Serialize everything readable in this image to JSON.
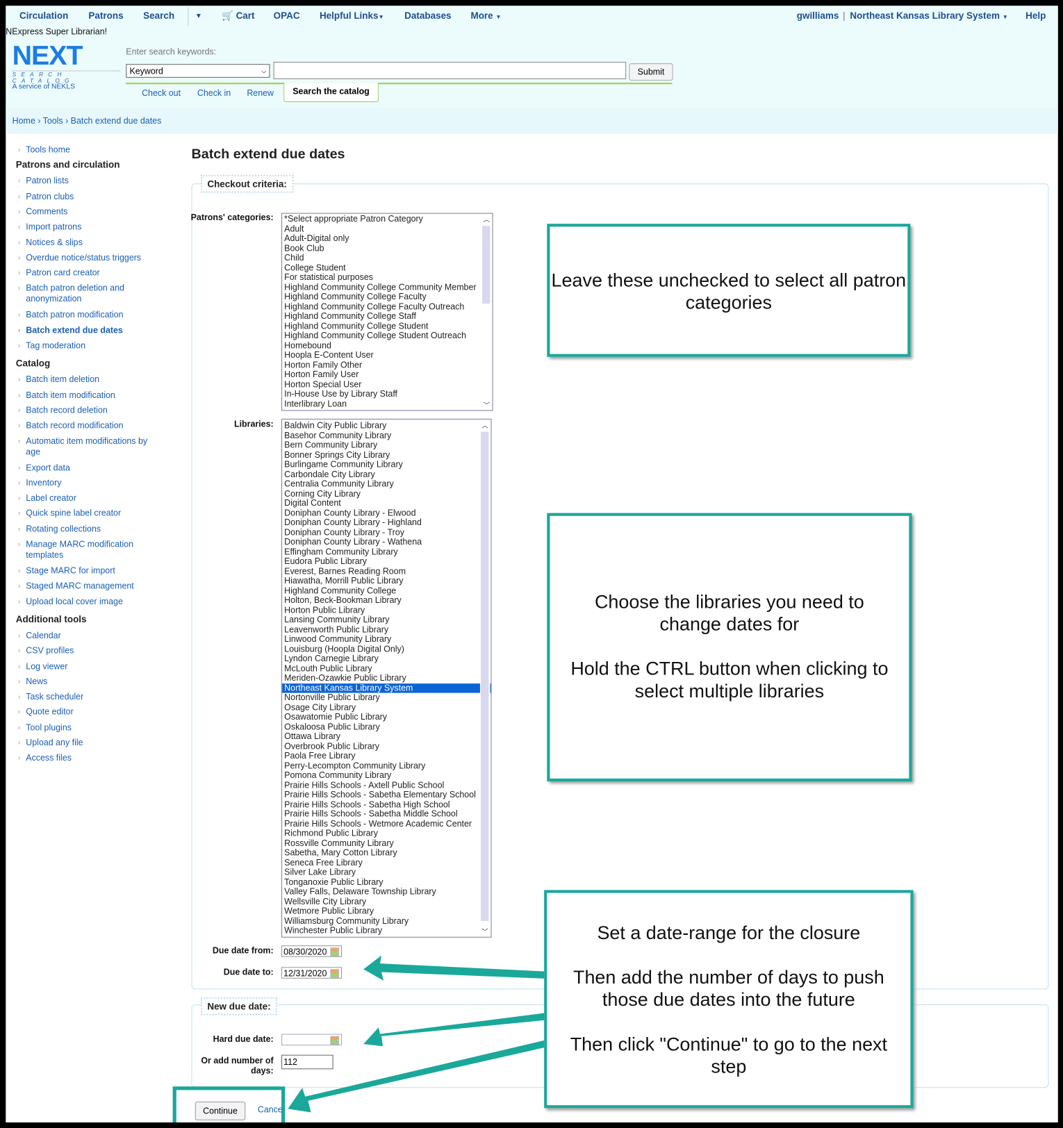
{
  "topnav": {
    "items": [
      "Circulation",
      "Patrons",
      "Search",
      "Cart",
      "OPAC",
      "Helpful Links",
      "Databases",
      "More"
    ],
    "user": "gwilliams",
    "library": "Northeast Kansas Library System",
    "help": "Help"
  },
  "greeting": "NExpress Super Librarian!",
  "logo": {
    "text": "NEXT",
    "sub": "SEARCH CATALOG",
    "service": "A service of NEKLS"
  },
  "search": {
    "prompt": "Enter search keywords:",
    "type": "Keyword",
    "value": "",
    "submit": "Submit",
    "tabs": [
      "Check out",
      "Check in",
      "Renew",
      "Search the catalog"
    ]
  },
  "breadcrumb": [
    "Home",
    "Tools",
    "Batch extend due dates"
  ],
  "sidebar": {
    "tools_home": "Tools home",
    "sections": [
      {
        "title": "Patrons and circulation",
        "items": [
          "Patron lists",
          "Patron clubs",
          "Comments",
          "Import patrons",
          "Notices & slips",
          "Overdue notice/status triggers",
          "Patron card creator",
          "Batch patron deletion and anonymization",
          "Batch patron modification",
          "Batch extend due dates",
          "Tag moderation"
        ]
      },
      {
        "title": "Catalog",
        "items": [
          "Batch item deletion",
          "Batch item modification",
          "Batch record deletion",
          "Batch record modification",
          "Automatic item modifications by age",
          "Export data",
          "Inventory",
          "Label creator",
          "Quick spine label creator",
          "Rotating collections",
          "Manage MARC modification templates",
          "Stage MARC for import",
          "Staged MARC management",
          "Upload local cover image"
        ]
      },
      {
        "title": "Additional tools",
        "items": [
          "Calendar",
          "CSV profiles",
          "Log viewer",
          "News",
          "Task scheduler",
          "Quote editor",
          "Tool plugins",
          "Upload any file",
          "Access files"
        ]
      }
    ],
    "active": "Batch extend due dates"
  },
  "main": {
    "title": "Batch extend due dates",
    "criteria_legend": "Checkout criteria:",
    "patron_label": "Patrons' categories:",
    "patron_categories": [
      "*Select appropriate Patron Category",
      "Adult",
      "Adult-Digital only",
      "Book Club",
      "Child",
      "College Student",
      "For statistical purposes",
      "Highland Community College Community Member",
      "Highland Community College Faculty",
      "Highland Community College Faculty Outreach",
      "Highland Community College Staff",
      "Highland Community College Student",
      "Highland Community College Student Outreach",
      "Homebound",
      "Hoopla E-Content User",
      "Horton Family Other",
      "Horton Family User",
      "Horton Special User",
      "In-House Use by Library Staff",
      "Interlibrary Loan"
    ],
    "libraries_label": "Libraries:",
    "libraries": [
      "Baldwin City Public Library",
      "Basehor Community Library",
      "Bern Community Library",
      "Bonner Springs City Library",
      "Burlingame Community Library",
      "Carbondale City Library",
      "Centralia Community Library",
      "Corning City Library",
      "Digital Content",
      "Doniphan County Library - Elwood",
      "Doniphan County Library - Highland",
      "Doniphan County Library - Troy",
      "Doniphan County Library - Wathena",
      "Effingham Community Library",
      "Eudora Public Library",
      "Everest, Barnes Reading Room",
      "Hiawatha, Morrill Public Library",
      "Highland Community College",
      "Holton, Beck-Bookman Library",
      "Horton Public Library",
      "Lansing Community Library",
      "Leavenworth Public Library",
      "Linwood Community Library",
      "Louisburg (Hoopla Digital Only)",
      "Lyndon Carnegie Library",
      "McLouth Public Library",
      "Meriden-Ozawkie Public Library",
      "Northeast Kansas Library System",
      "Nortonville Public Library",
      "Osage City Library",
      "Osawatomie Public Library",
      "Oskaloosa Public Library",
      "Ottawa Library",
      "Overbrook Public Library",
      "Paola Free Library",
      "Perry-Lecompton Community Library",
      "Pomona Community Library",
      "Prairie Hills Schools - Axtell Public School",
      "Prairie Hills Schools - Sabetha Elementary School",
      "Prairie Hills Schools - Sabetha High School",
      "Prairie Hills Schools - Sabetha Middle School",
      "Prairie Hills Schools - Wetmore Academic Center",
      "Richmond Public Library",
      "Rossville Community Library",
      "Sabetha, Mary Cotton Library",
      "Seneca Free Library",
      "Silver Lake Library",
      "Tonganoxie Public Library",
      "Valley Falls, Delaware Township Library",
      "Wellsville City Library",
      "Wetmore Public Library",
      "Williamsburg Community Library",
      "Winchester Public Library"
    ],
    "selected_library": "Northeast Kansas Library System",
    "due_from_label": "Due date from:",
    "due_from": "08/30/2020",
    "due_to_label": "Due date to:",
    "due_to": "12/31/2020",
    "new_legend": "New due date:",
    "hard_label": "Hard due date:",
    "hard_value": "",
    "days_label": "Or add number of days:",
    "days_value": "112",
    "continue": "Continue",
    "cancel": "Cancel"
  },
  "callouts": {
    "c1": "Leave these unchecked to select all patron categories",
    "c2a": "Choose the libraries you need to change dates for",
    "c2b": "Hold the CTRL button when clicking to select multiple libraries",
    "c3a": "Set a date-range for the closure",
    "c3b": "Then add the number of days to push those due dates into the future",
    "c3c": "Then click \"Continue\" to go to the next step"
  },
  "colors": {
    "callout": "#1aa89a",
    "link": "#1a5fb4",
    "selected": "#0a64d6"
  }
}
